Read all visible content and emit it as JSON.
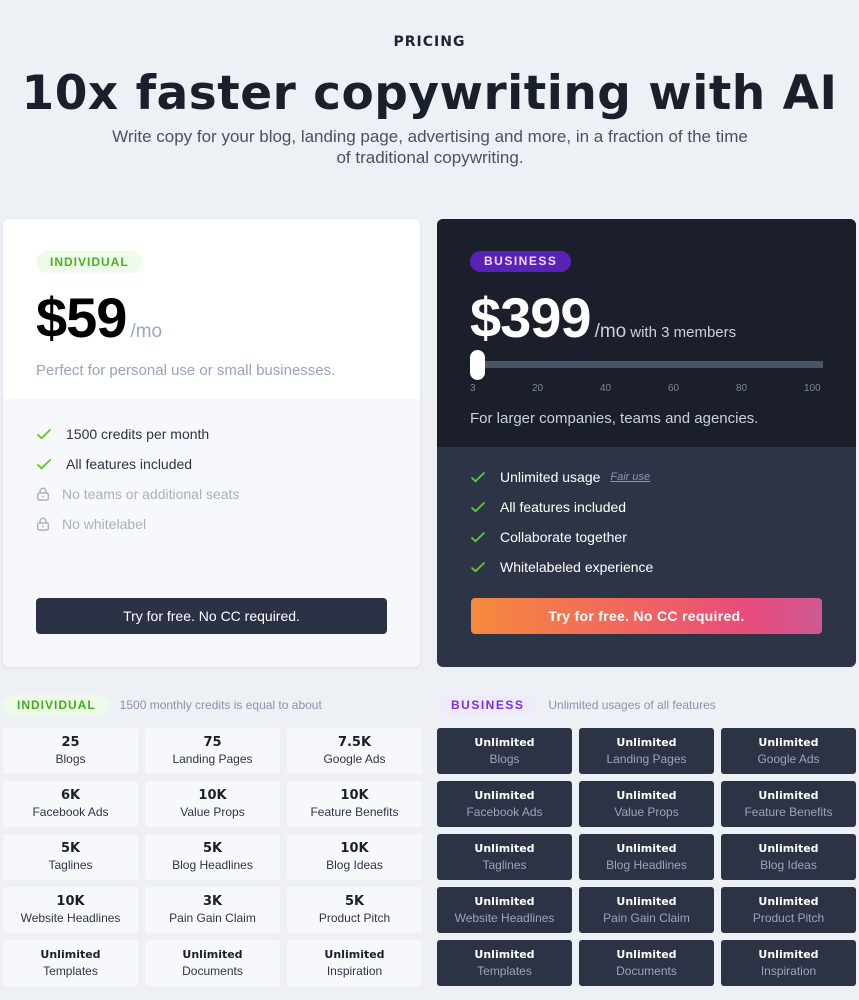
{
  "header": {
    "eyebrow": "PRICING",
    "title": "10x faster copywriting with AI",
    "subtitle": "Write copy for your blog, landing page, advertising and more, in a fraction of the time of traditional copywriting."
  },
  "plans": {
    "individual": {
      "badge": "INDIVIDUAL",
      "price": "$59",
      "unit": "/mo",
      "description": "Perfect for personal use or small businesses.",
      "features": [
        {
          "text": "1500 credits per month",
          "included": true
        },
        {
          "text": "All features included",
          "included": true
        },
        {
          "text": "No teams or additional seats",
          "included": false
        },
        {
          "text": "No whitelabel",
          "included": false
        }
      ],
      "cta": "Try for free. No CC required."
    },
    "business": {
      "badge": "BUSINESS",
      "price": "$399",
      "unit": "/mo",
      "members_text": "with 3 members",
      "slider": {
        "value": 3,
        "min": 3,
        "max": 100,
        "ticks": [
          "3",
          "20",
          "40",
          "60",
          "80",
          "100"
        ]
      },
      "description": "For larger companies, teams and agencies.",
      "features": [
        {
          "text": "Unlimited usage",
          "included": true,
          "link": "Fair use"
        },
        {
          "text": "All features included",
          "included": true
        },
        {
          "text": "Collaborate together",
          "included": true
        },
        {
          "text": "Whitelabeled experience",
          "included": true
        }
      ],
      "cta": "Try for free. No CC required."
    }
  },
  "usage": {
    "individual": {
      "badge": "INDIVIDUAL",
      "note": "1500 monthly credits is equal to about",
      "items": [
        {
          "value": "25",
          "label": "Blogs"
        },
        {
          "value": "75",
          "label": "Landing Pages"
        },
        {
          "value": "7.5K",
          "label": "Google Ads"
        },
        {
          "value": "6K",
          "label": "Facebook Ads"
        },
        {
          "value": "10K",
          "label": "Value Props"
        },
        {
          "value": "10K",
          "label": "Feature Benefits"
        },
        {
          "value": "5K",
          "label": "Taglines"
        },
        {
          "value": "5K",
          "label": "Blog Headlines"
        },
        {
          "value": "10K",
          "label": "Blog Ideas"
        },
        {
          "value": "10K",
          "label": "Website Headlines"
        },
        {
          "value": "3K",
          "label": "Pain Gain Claim"
        },
        {
          "value": "5K",
          "label": "Product Pitch"
        },
        {
          "value": "Unlimited",
          "label": "Templates"
        },
        {
          "value": "Unlimited",
          "label": "Documents"
        },
        {
          "value": "Unlimited",
          "label": "Inspiration"
        }
      ]
    },
    "business": {
      "badge": "BUSINESS",
      "note": "Unlimited usages of all features",
      "items": [
        {
          "value": "Unlimited",
          "label": "Blogs"
        },
        {
          "value": "Unlimited",
          "label": "Landing Pages"
        },
        {
          "value": "Unlimited",
          "label": "Google Ads"
        },
        {
          "value": "Unlimited",
          "label": "Facebook Ads"
        },
        {
          "value": "Unlimited",
          "label": "Value Props"
        },
        {
          "value": "Unlimited",
          "label": "Feature Benefits"
        },
        {
          "value": "Unlimited",
          "label": "Taglines"
        },
        {
          "value": "Unlimited",
          "label": "Blog Headlines"
        },
        {
          "value": "Unlimited",
          "label": "Blog Ideas"
        },
        {
          "value": "Unlimited",
          "label": "Website Headlines"
        },
        {
          "value": "Unlimited",
          "label": "Pain Gain Claim"
        },
        {
          "value": "Unlimited",
          "label": "Product Pitch"
        },
        {
          "value": "Unlimited",
          "label": "Templates"
        },
        {
          "value": "Unlimited",
          "label": "Documents"
        },
        {
          "value": "Unlimited",
          "label": "Inspiration"
        }
      ]
    }
  },
  "colors": {
    "page_bg": "#edf1f6",
    "dark_card": "#1b1f2b",
    "dark_card_lower": "#2d3445",
    "check_green": "#5ccb2d",
    "business_purple": "#5a21b6",
    "cta_gradient_start": "#f58a3c",
    "cta_gradient_end": "#cf5a94"
  }
}
